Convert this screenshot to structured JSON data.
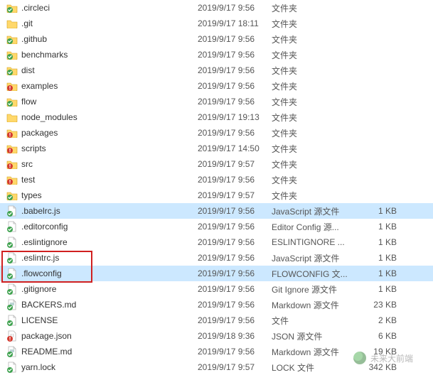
{
  "icons": {
    "folder-yellow": "folder",
    "folder-green-check": "folder-check",
    "folder-red-excl": "folder-excl",
    "file-js-green": "js-green",
    "file-js-red": "js-red",
    "file-generic-green": "generic",
    "file-note": "note",
    "file-json-red": "json"
  },
  "watermark": "未来大前端",
  "rows": [
    {
      "icon": "folder-green-check",
      "name": ".circleci",
      "date": "2019/9/17 9:56",
      "type": "文件夹",
      "size": "",
      "selected": false
    },
    {
      "icon": "folder-yellow",
      "name": ".git",
      "date": "2019/9/17 18:11",
      "type": "文件夹",
      "size": "",
      "selected": false
    },
    {
      "icon": "folder-green-check",
      "name": ".github",
      "date": "2019/9/17 9:56",
      "type": "文件夹",
      "size": "",
      "selected": false
    },
    {
      "icon": "folder-green-check",
      "name": "benchmarks",
      "date": "2019/9/17 9:56",
      "type": "文件夹",
      "size": "",
      "selected": false
    },
    {
      "icon": "folder-green-check",
      "name": "dist",
      "date": "2019/9/17 9:56",
      "type": "文件夹",
      "size": "",
      "selected": false
    },
    {
      "icon": "folder-red-excl",
      "name": "examples",
      "date": "2019/9/17 9:56",
      "type": "文件夹",
      "size": "",
      "selected": false
    },
    {
      "icon": "folder-green-check",
      "name": "flow",
      "date": "2019/9/17 9:56",
      "type": "文件夹",
      "size": "",
      "selected": false
    },
    {
      "icon": "folder-yellow",
      "name": "node_modules",
      "date": "2019/9/17 19:13",
      "type": "文件夹",
      "size": "",
      "selected": false
    },
    {
      "icon": "folder-red-excl",
      "name": "packages",
      "date": "2019/9/17 9:56",
      "type": "文件夹",
      "size": "",
      "selected": false
    },
    {
      "icon": "folder-red-excl",
      "name": "scripts",
      "date": "2019/9/17 14:50",
      "type": "文件夹",
      "size": "",
      "selected": false
    },
    {
      "icon": "folder-red-excl",
      "name": "src",
      "date": "2019/9/17 9:57",
      "type": "文件夹",
      "size": "",
      "selected": false
    },
    {
      "icon": "folder-red-excl",
      "name": "test",
      "date": "2019/9/17 9:56",
      "type": "文件夹",
      "size": "",
      "selected": false
    },
    {
      "icon": "folder-green-check",
      "name": "types",
      "date": "2019/9/17 9:57",
      "type": "文件夹",
      "size": "",
      "selected": false
    },
    {
      "icon": "file-js-green",
      "name": ".babelrc.js",
      "date": "2019/9/17 9:56",
      "type": "JavaScript 源文件",
      "size": "1 KB",
      "selected": true
    },
    {
      "icon": "file-generic-green",
      "name": ".editorconfig",
      "date": "2019/9/17 9:56",
      "type": "Editor Config 源...",
      "size": "1 KB",
      "selected": false
    },
    {
      "icon": "file-generic-green",
      "name": ".eslintignore",
      "date": "2019/9/17 9:56",
      "type": "ESLINTIGNORE ...",
      "size": "1 KB",
      "selected": false
    },
    {
      "icon": "file-js-green",
      "name": ".eslintrc.js",
      "date": "2019/9/17 9:56",
      "type": "JavaScript 源文件",
      "size": "1 KB",
      "selected": false
    },
    {
      "icon": "file-generic-green",
      "name": ".flowconfig",
      "date": "2019/9/17 9:56",
      "type": "FLOWCONFIG 文...",
      "size": "1 KB",
      "selected": true
    },
    {
      "icon": "file-generic-green",
      "name": ".gitignore",
      "date": "2019/9/17 9:56",
      "type": "Git Ignore 源文件",
      "size": "1 KB",
      "selected": false
    },
    {
      "icon": "file-note",
      "name": "BACKERS.md",
      "date": "2019/9/17 9:56",
      "type": "Markdown 源文件",
      "size": "23 KB",
      "selected": false
    },
    {
      "icon": "file-generic-green",
      "name": "LICENSE",
      "date": "2019/9/17 9:56",
      "type": "文件",
      "size": "2 KB",
      "selected": false
    },
    {
      "icon": "file-json-red",
      "name": "package.json",
      "date": "2019/9/18 9:36",
      "type": "JSON 源文件",
      "size": "6 KB",
      "selected": false
    },
    {
      "icon": "file-note",
      "name": "README.md",
      "date": "2019/9/17 9:56",
      "type": "Markdown 源文件",
      "size": "19 KB",
      "selected": false
    },
    {
      "icon": "file-generic-green",
      "name": "yarn.lock",
      "date": "2019/9/17 9:57",
      "type": "LOCK 文件",
      "size": "342 KB",
      "selected": false
    }
  ]
}
